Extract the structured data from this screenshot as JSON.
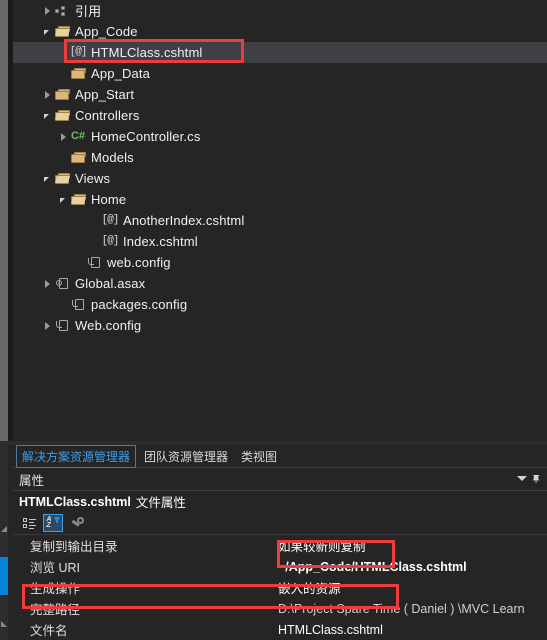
{
  "solution_explorer": {
    "tree": [
      {
        "indent": 0,
        "expander": "closed",
        "icon": "references-icon",
        "label": "引用",
        "selected": false
      },
      {
        "indent": 0,
        "expander": "open",
        "icon": "folder-open-icon",
        "label": "App_Code",
        "selected": false
      },
      {
        "indent": 1,
        "expander": "none",
        "icon": "razor-file-icon",
        "label": "HTMLClass.cshtml",
        "selected": true
      },
      {
        "indent": 1,
        "expander": "none",
        "icon": "folder-icon",
        "label": "App_Data",
        "selected": false
      },
      {
        "indent": 0,
        "expander": "closed",
        "icon": "folder-icon",
        "label": "App_Start",
        "selected": false
      },
      {
        "indent": 0,
        "expander": "open",
        "icon": "folder-open-icon",
        "label": "Controllers",
        "selected": false
      },
      {
        "indent": 1,
        "expander": "closed",
        "icon": "csharp-file-icon",
        "label": "HomeController.cs",
        "selected": false
      },
      {
        "indent": 1,
        "expander": "none",
        "icon": "folder-icon",
        "label": "Models",
        "selected": false
      },
      {
        "indent": 0,
        "expander": "open",
        "icon": "folder-open-icon",
        "label": "Views",
        "selected": false
      },
      {
        "indent": 1,
        "expander": "open",
        "icon": "folder-open-icon",
        "label": "Home",
        "selected": false
      },
      {
        "indent": 3,
        "expander": "none",
        "icon": "razor-file-icon",
        "label": "AnotherIndex.cshtml",
        "selected": false
      },
      {
        "indent": 3,
        "expander": "none",
        "icon": "razor-file-icon",
        "label": "Index.cshtml",
        "selected": false
      },
      {
        "indent": 2,
        "expander": "none",
        "icon": "config-file-icon",
        "label": "web.config",
        "selected": false
      },
      {
        "indent": 0,
        "expander": "closed",
        "icon": "asax-file-icon",
        "label": "Global.asax",
        "selected": false
      },
      {
        "indent": 1,
        "expander": "none",
        "icon": "config-file-icon",
        "label": "packages.config",
        "selected": false
      },
      {
        "indent": 0,
        "expander": "closed",
        "icon": "config-file-icon",
        "label": "Web.config",
        "selected": false
      }
    ]
  },
  "tabs": [
    {
      "label": "解决方案资源管理器",
      "active": true
    },
    {
      "label": "团队资源管理器",
      "active": false
    },
    {
      "label": "类视图",
      "active": false
    }
  ],
  "properties": {
    "panel_title": "属性",
    "chevron_icon": "chevron-down-icon",
    "pin_icon": "pin-icon",
    "object_name": "HTMLClass.cshtml",
    "object_kind": "文件属性",
    "toolbar": [
      {
        "name": "categorized-icon",
        "label": "按分类",
        "active": false
      },
      {
        "name": "alphabetical-sort-icon",
        "label": "按字母顺序",
        "active": true
      },
      {
        "name": "property-pages-icon",
        "label": "属性页",
        "active": false
      }
    ],
    "rows": [
      {
        "name": "复制到输出目录",
        "value": "如果较新则复制",
        "style": "normal"
      },
      {
        "name": "浏览 URI",
        "value": "~/App_Code/HTMLClass.cshtml",
        "style": "bold"
      },
      {
        "name": "生成操作",
        "value": "嵌入的资源",
        "style": "normal"
      },
      {
        "name": "完整路径",
        "value": "D:\\Project Spare Time ( Daniel ) \\MVC Learn",
        "style": "dim"
      },
      {
        "name": "文件名",
        "value": "HTMLClass.cshtml",
        "style": "normal"
      }
    ]
  },
  "annotations": {
    "highlight_color": "#ef3b3b",
    "boxes": [
      {
        "name": "selected-file-highlight",
        "target": "HTMLClass.cshtml"
      },
      {
        "name": "copy-to-output-value-highlight",
        "target": "如果较新则复制"
      },
      {
        "name": "build-action-row-highlight",
        "target": "生成操作"
      }
    ]
  }
}
